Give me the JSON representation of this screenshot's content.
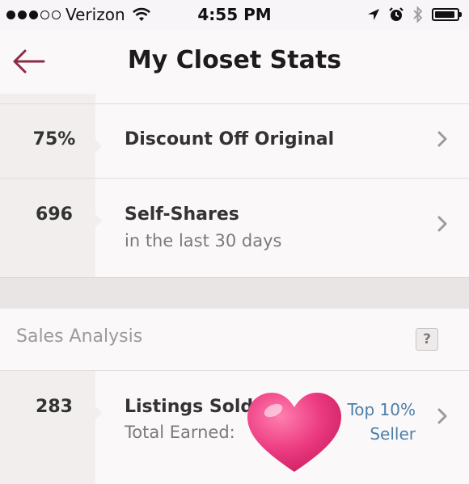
{
  "status_bar": {
    "carrier": "Verizon",
    "time": "4:55 PM"
  },
  "nav": {
    "title": "My Closet Stats"
  },
  "stats": [
    {
      "value": "75%",
      "label": "Discount Off Original",
      "sub": ""
    },
    {
      "value": "696",
      "label": "Self-Shares",
      "sub": "in the last 30 days"
    }
  ],
  "sales_analysis": {
    "title": "Sales Analysis",
    "help": "?",
    "row": {
      "value": "283",
      "label": "Listings Sold",
      "sub": "Total Earned:",
      "badge_line1": "Top 10%",
      "badge_line2": "Seller"
    }
  },
  "colors": {
    "accent": "#8b2b45",
    "link_blue": "#4d7fa8",
    "heart_pink": "#e8367a"
  }
}
